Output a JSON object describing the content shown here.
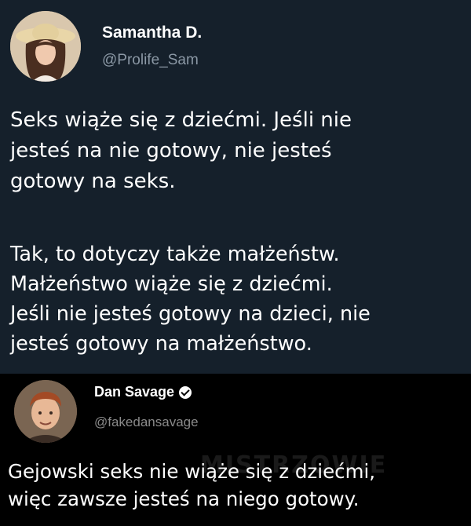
{
  "tweet1": {
    "author_name": "Samantha D.",
    "author_handle": "@Prolife_Sam",
    "body_p1": "Seks wiąże się z dziećmi. Jeśli nie\njesteś na nie gotowy, nie jesteś\ngotowy na seks.",
    "body_p2": "Tak, to dotyczy także małżeństw.\nMałżeństwo wiąże się z dziećmi.\nJeśli nie jesteś gotowy na dzieci, nie\njesteś gotowy na małżeństwo."
  },
  "tweet2": {
    "author_name": "Dan Savage",
    "author_handle": "@fakedansavage",
    "verified_icon": "verified-badge-icon",
    "body": "Gejowski seks nie wiąże się z dziećmi,\nwięc zawsze jesteś na niego gotowy."
  },
  "watermark": "MISTRZOWIE"
}
